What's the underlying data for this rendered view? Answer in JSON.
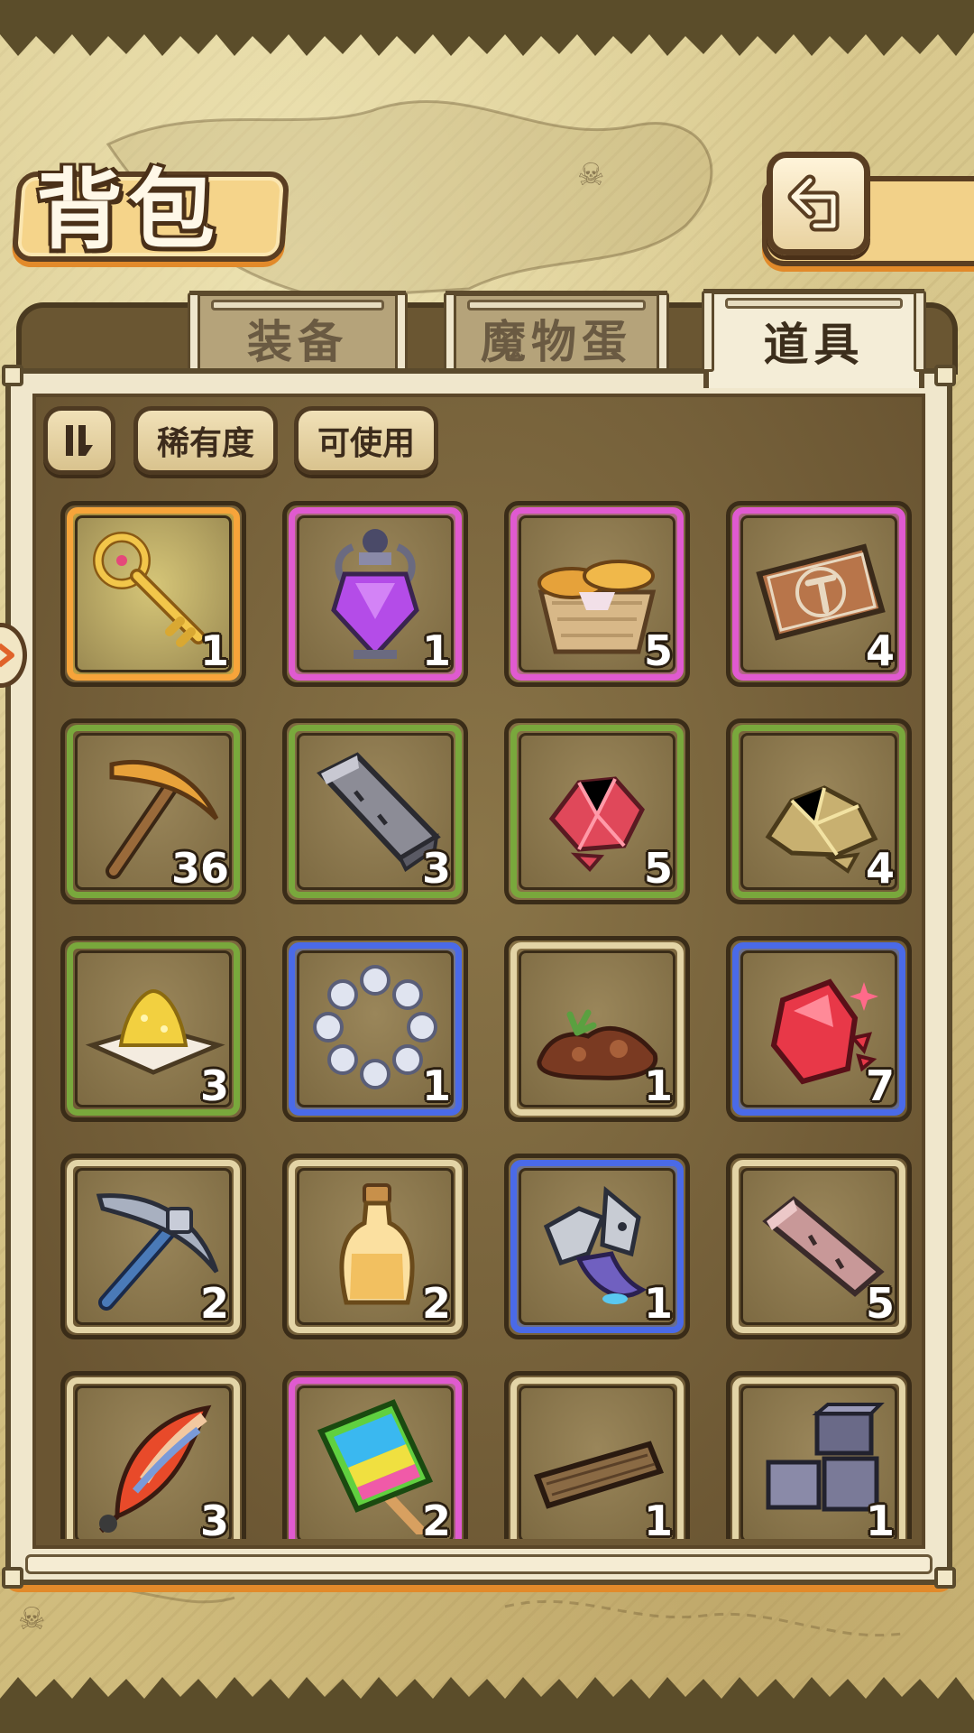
{
  "header": {
    "title": "背包"
  },
  "tabs": [
    {
      "label": "装备",
      "active": false
    },
    {
      "label": "魔物蛋",
      "active": false
    },
    {
      "label": "道具",
      "active": true
    }
  ],
  "filters": {
    "sort_icon": "sort-icon",
    "rarity_label": "稀有度",
    "usable_label": "可使用"
  },
  "colors": {
    "legendary": "#f7a43a",
    "epic": "#e05ad0",
    "uncommon": "#79a83c",
    "rare": "#4a6ae8",
    "common": "#e3d4a6"
  },
  "items": [
    {
      "icon": "golden-key-icon",
      "rarity": "orange",
      "count": "1"
    },
    {
      "icon": "purple-potion-icon",
      "rarity": "pink",
      "count": "1"
    },
    {
      "icon": "bread-basket-icon",
      "rarity": "pink",
      "count": "5"
    },
    {
      "icon": "hammer-ticket-icon",
      "rarity": "pink",
      "count": "4"
    },
    {
      "icon": "gold-pickaxe-icon",
      "rarity": "green",
      "count": "36"
    },
    {
      "icon": "iron-ingot-icon",
      "rarity": "green",
      "count": "3"
    },
    {
      "icon": "red-crystal-icon",
      "rarity": "green",
      "count": "5"
    },
    {
      "icon": "gold-ore-icon",
      "rarity": "green",
      "count": "4"
    },
    {
      "icon": "sugar-powder-icon",
      "rarity": "green",
      "count": "3"
    },
    {
      "icon": "pearl-bracelet-icon",
      "rarity": "blue",
      "count": "1"
    },
    {
      "icon": "soil-pile-icon",
      "rarity": "tan",
      "count": "1"
    },
    {
      "icon": "ruby-icon",
      "rarity": "blue",
      "count": "7"
    },
    {
      "icon": "steel-pickaxe-icon",
      "rarity": "tan",
      "count": "2"
    },
    {
      "icon": "oil-bottle-icon",
      "rarity": "tan",
      "count": "2"
    },
    {
      "icon": "monster-scrap-icon",
      "rarity": "blue",
      "count": "1"
    },
    {
      "icon": "stone-bar-icon",
      "rarity": "tan",
      "count": "5"
    },
    {
      "icon": "feather-icon",
      "rarity": "tan",
      "count": "3"
    },
    {
      "icon": "rainbow-popsicle-icon",
      "rarity": "pink",
      "count": "2"
    },
    {
      "icon": "wood-plank-icon",
      "rarity": "tan",
      "count": "1"
    },
    {
      "icon": "stone-blocks-icon",
      "rarity": "tan",
      "count": "1"
    }
  ]
}
